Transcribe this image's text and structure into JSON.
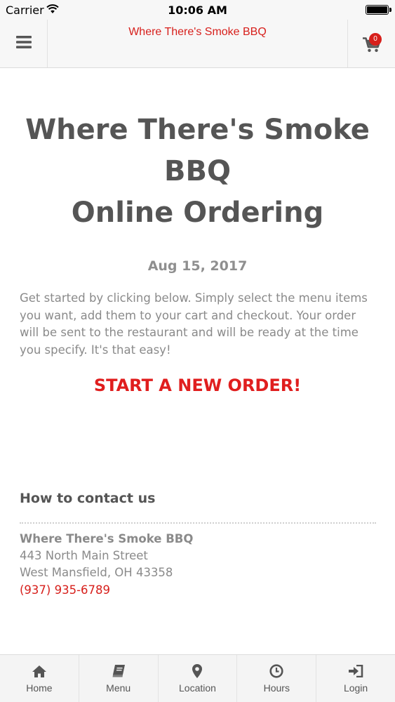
{
  "status_bar": {
    "carrier": "Carrier",
    "time": "10:06 AM"
  },
  "header": {
    "title": "Where There's Smoke BBQ",
    "cart_count": "0",
    "menu_icon": "hamburger-icon",
    "cart_icon": "cart-icon"
  },
  "main": {
    "title_line1": "Where There's Smoke",
    "title_line2": "BBQ",
    "title_line3": "Online Ordering",
    "date": "Aug 15, 2017",
    "intro": "Get started by clicking below. Simply select the menu items you want, add them to your cart and checkout. Your order will be sent to the restaurant and will be ready at the time you specify. It's that easy!",
    "cta": "START A NEW ORDER!"
  },
  "contact": {
    "heading": "How to contact us",
    "name": "Where There's Smoke BBQ",
    "address1": "443 North Main Street",
    "address2": "West Mansfield, OH 43358",
    "phone": "(937) 935-6789"
  },
  "tabs": [
    {
      "label": "Home",
      "icon": "home-icon"
    },
    {
      "label": "Menu",
      "icon": "book-icon"
    },
    {
      "label": "Location",
      "icon": "map-pin-icon"
    },
    {
      "label": "Hours",
      "icon": "clock-icon"
    },
    {
      "label": "Login",
      "icon": "login-icon"
    }
  ],
  "colors": {
    "accent": "#d71f1b",
    "cta": "#e01e1e",
    "text_dark": "#555555",
    "text_muted": "#8a8a8a"
  }
}
